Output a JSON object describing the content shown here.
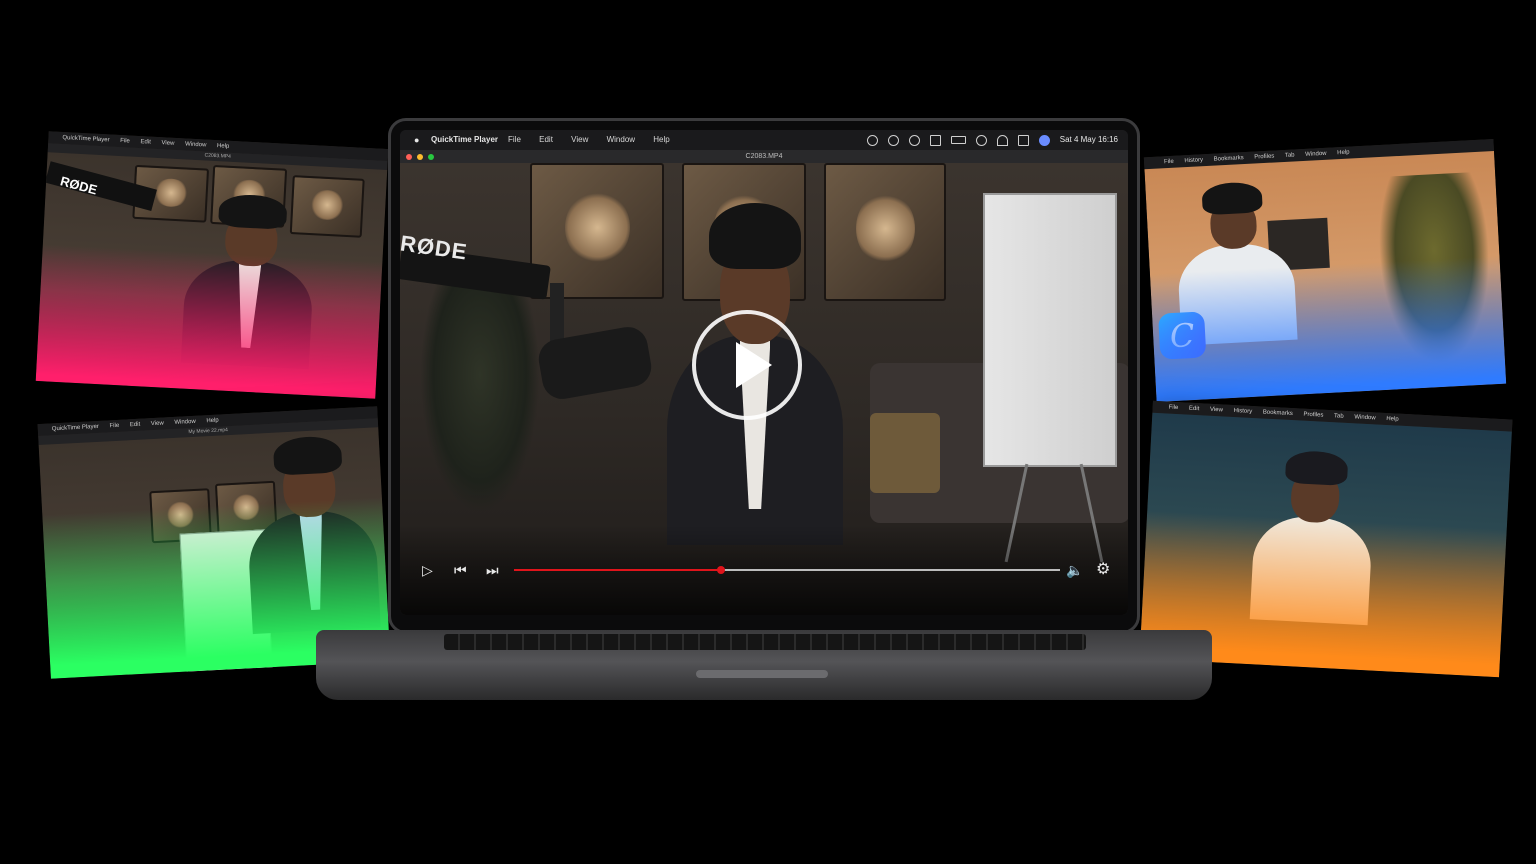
{
  "colors": {
    "progress": "#e0141b",
    "menubar": "#1a1a1c",
    "panel_gradients": [
      "#ff1f6b",
      "#2bff62",
      "#2f7bff",
      "#ff8a1a"
    ]
  },
  "main_window": {
    "app_name": "QuickTime Player",
    "menus": [
      "File",
      "Edit",
      "View",
      "Window",
      "Help"
    ],
    "status_icons": [
      "control-center-icon",
      "siri-icon",
      "screen-time-icon",
      "keyboard-icon",
      "battery-icon",
      "spotlight-icon",
      "wifi-icon",
      "screen-mirror-icon",
      "user-icon"
    ],
    "clock": "Sat 4 May 16:16",
    "file_title": "C2083.MP4",
    "mic_brand": "RØDE",
    "progress_fraction": 0.38,
    "controls": [
      "play-icon",
      "skip-back-icon",
      "skip-forward-icon",
      "volume-icon",
      "settings-icon"
    ]
  },
  "panels": [
    {
      "id": "top-left",
      "menus": [
        "QuickTime Player",
        "File",
        "Edit",
        "View",
        "Window",
        "Help"
      ],
      "title": "C2083.MP4",
      "mic_brand": "RØDE",
      "gradient": "#ff1f6b"
    },
    {
      "id": "bottom-left",
      "menus": [
        "QuickTime Player",
        "File",
        "Edit",
        "View",
        "Window",
        "Help"
      ],
      "title": "My Movie 22.mp4",
      "gradient": "#2bff62"
    },
    {
      "id": "top-right",
      "menus": [
        "File",
        "History",
        "Bookmarks",
        "Profiles",
        "Tab",
        "Window",
        "Help"
      ],
      "logo": "C",
      "gradient": "#2f7bff"
    },
    {
      "id": "bottom-right",
      "menus": [
        "File",
        "Edit",
        "View",
        "History",
        "Bookmarks",
        "Profiles",
        "Tab",
        "Window",
        "Help"
      ],
      "gradient": "#ff8a1a"
    }
  ]
}
